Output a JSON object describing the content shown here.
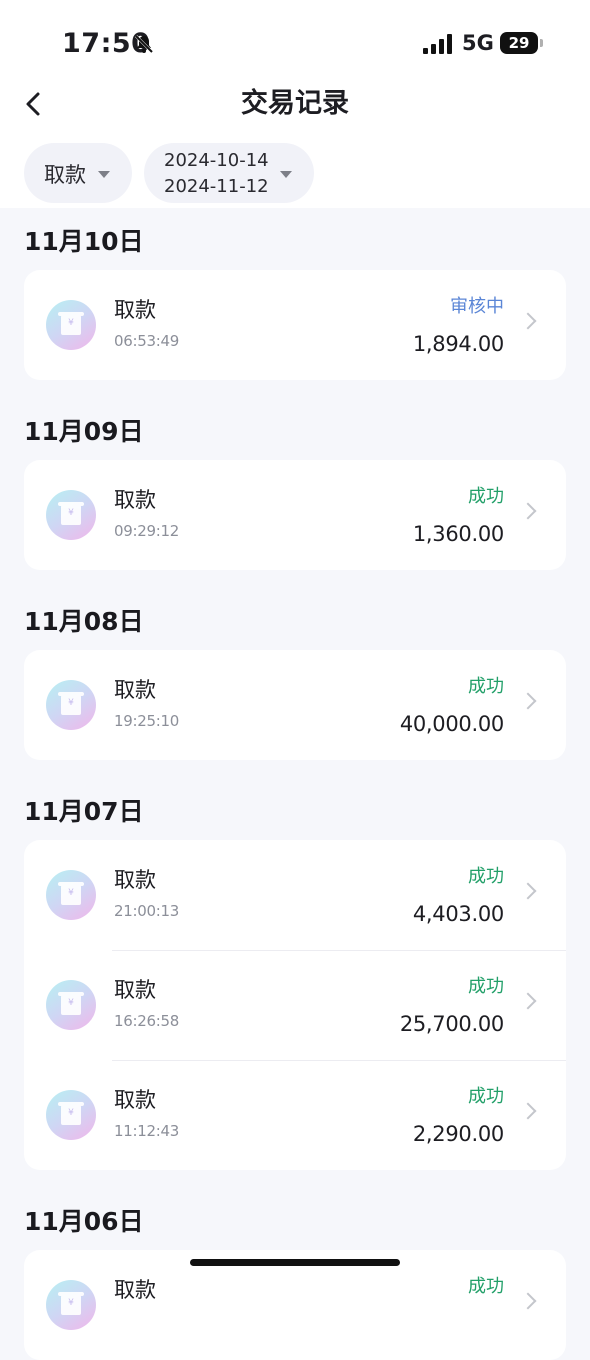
{
  "status_bar": {
    "time": "17:50",
    "network": "5G",
    "battery": "29"
  },
  "header": {
    "title": "交易记录"
  },
  "filters": {
    "type": "取款",
    "date_start": "2024-10-14",
    "date_end": "2024-11-12"
  },
  "colors": {
    "pending": "#5b86d6",
    "success": "#23a06a"
  },
  "sections": [
    {
      "date": "11月10日",
      "items": [
        {
          "name": "取款",
          "time": "06:53:49",
          "status": "审核中",
          "status_color": "#5b86d6",
          "amount": "1,894.00"
        }
      ]
    },
    {
      "date": "11月09日",
      "items": [
        {
          "name": "取款",
          "time": "09:29:12",
          "status": "成功",
          "status_color": "#23a06a",
          "amount": "1,360.00"
        }
      ]
    },
    {
      "date": "11月08日",
      "items": [
        {
          "name": "取款",
          "time": "19:25:10",
          "status": "成功",
          "status_color": "#23a06a",
          "amount": "40,000.00"
        }
      ]
    },
    {
      "date": "11月07日",
      "items": [
        {
          "name": "取款",
          "time": "21:00:13",
          "status": "成功",
          "status_color": "#23a06a",
          "amount": "4,403.00"
        },
        {
          "name": "取款",
          "time": "16:26:58",
          "status": "成功",
          "status_color": "#23a06a",
          "amount": "25,700.00"
        },
        {
          "name": "取款",
          "time": "11:12:43",
          "status": "成功",
          "status_color": "#23a06a",
          "amount": "2,290.00"
        }
      ]
    },
    {
      "date": "11月06日",
      "items": [
        {
          "name": "取款",
          "time": "",
          "status": "成功",
          "status_color": "#23a06a",
          "amount": ""
        }
      ]
    }
  ]
}
